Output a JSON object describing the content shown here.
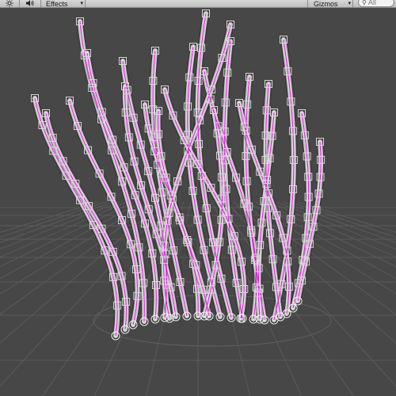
{
  "toolbar": {
    "sun_icon": "sun-icon",
    "audio_icon": "speaker-icon",
    "effects_label": "Effects",
    "gizmos_label": "Gizmos",
    "search_placeholder": "All",
    "dropdown_glyph": "▾"
  },
  "scene": {
    "background_color": "#474747",
    "grid_color": "#5a5a5a",
    "curve_color": "#e01ee0",
    "strand_color": "#e6e6e6",
    "handle_color": "#d8d8d8"
  }
}
